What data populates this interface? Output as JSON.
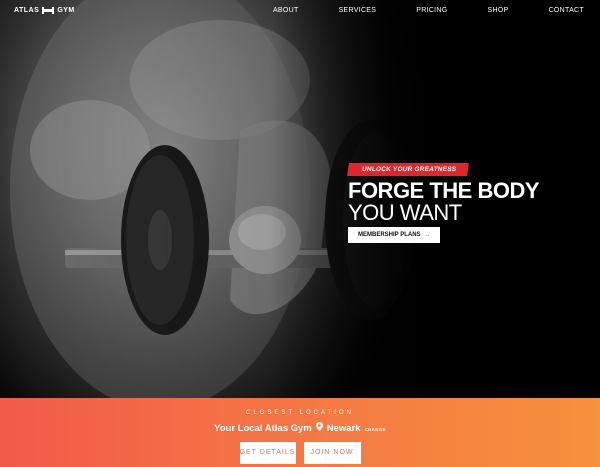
{
  "brand": {
    "left": "ATLAS",
    "right": "GYM"
  },
  "nav": [
    "ABOUT",
    "SERVICES",
    "PRICING",
    "SHOP",
    "CONTACT"
  ],
  "hero": {
    "tag": "UNLOCK YOUR GREATNESS",
    "headline_line1": "FORGE THE BODY",
    "headline_line2": "YOU WANT",
    "cta": "MEMBERSHIP PLANS",
    "cta_arrow": "→"
  },
  "location": {
    "kicker": "CLOSEST LOCATION",
    "title": "Your Local Atlas Gym",
    "city": "Newark",
    "change": "CHANGE",
    "buttons": [
      "GET DETAILS",
      "JOIN NOW"
    ]
  },
  "colors": {
    "accent": "#e3242b",
    "footer_start": "#f25a4a",
    "footer_end": "#f6913d"
  }
}
